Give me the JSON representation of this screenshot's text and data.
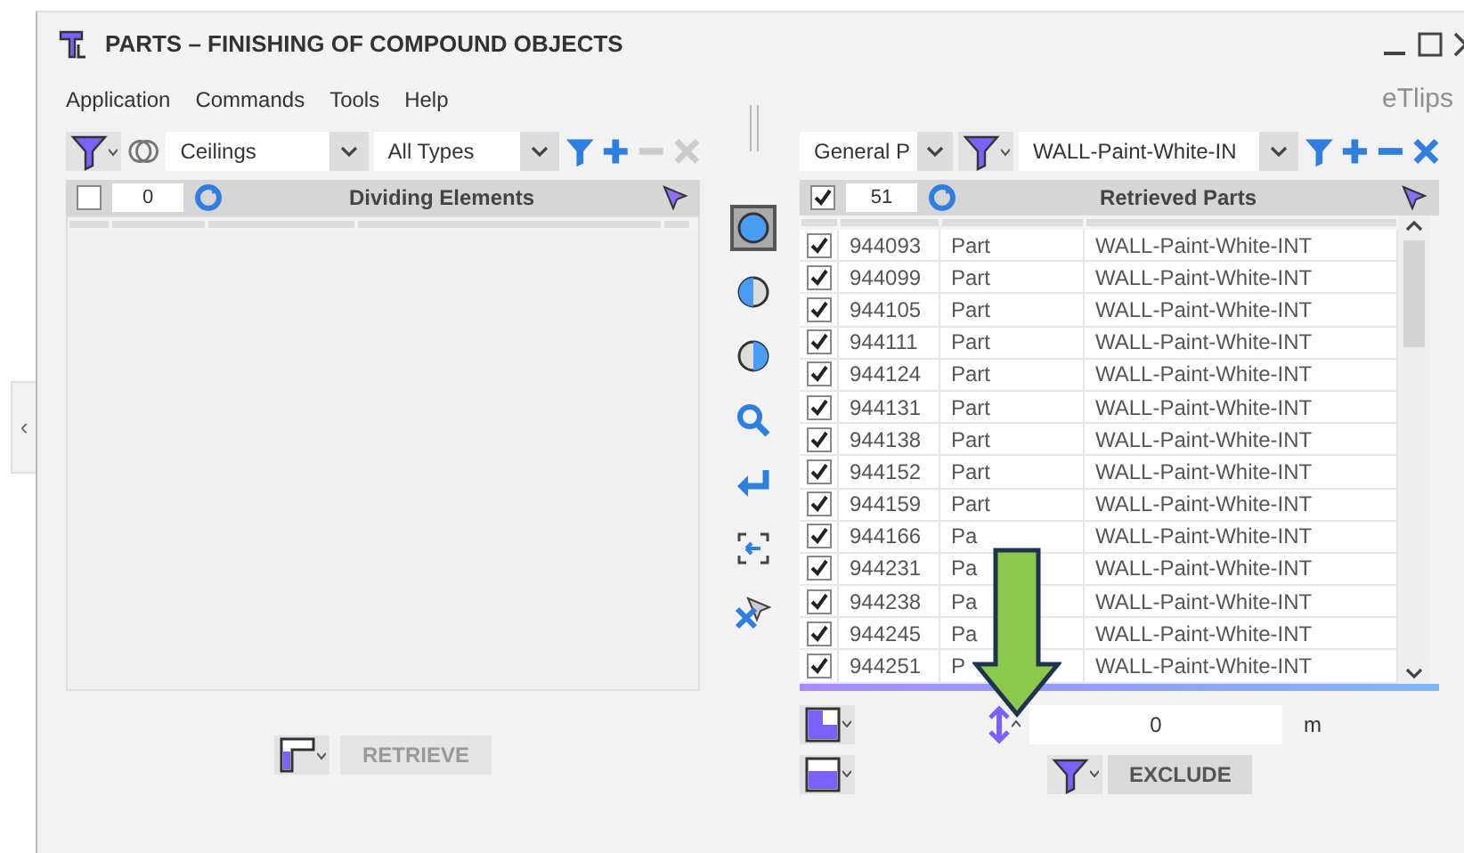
{
  "side_handle": {
    "glyph": "‹"
  },
  "window": {
    "title": "PARTS – FINISHING OF COMPOUND OBJECTS",
    "brand": "eTlips"
  },
  "menu": [
    "Application",
    "Commands",
    "Tools",
    "Help"
  ],
  "left_panel": {
    "toolbar": {
      "dropdowns": [
        {
          "value": "Ceilings"
        },
        {
          "value": "All Types"
        }
      ],
      "actions": [
        {
          "kind": "filter",
          "disabled": false
        },
        {
          "kind": "add",
          "disabled": false
        },
        {
          "kind": "remove",
          "disabled": true
        },
        {
          "kind": "clear",
          "disabled": true
        }
      ]
    },
    "header": {
      "checked": false,
      "count": "0",
      "title": "Dividing Elements"
    },
    "button": {
      "label": "RETRIEVE",
      "disabled": true
    }
  },
  "tools": [
    {
      "kind": "full",
      "selected": true
    },
    {
      "kind": "half-left",
      "selected": false
    },
    {
      "kind": "half-right",
      "selected": false
    },
    {
      "kind": "zoom",
      "selected": false
    },
    {
      "kind": "return",
      "selected": false
    },
    {
      "kind": "focus",
      "selected": false
    },
    {
      "kind": "deselect",
      "selected": false
    }
  ],
  "right_panel": {
    "toolbar": {
      "dropdowns": [
        {
          "value": "General P"
        },
        {
          "value": "WALL-Paint-White-IN"
        }
      ],
      "actions": [
        {
          "kind": "filter",
          "disabled": false
        },
        {
          "kind": "add",
          "disabled": false
        },
        {
          "kind": "remove",
          "disabled": false
        },
        {
          "kind": "clear",
          "disabled": false
        }
      ]
    },
    "header": {
      "checked": true,
      "count": "51",
      "title": "Retrieved Parts"
    },
    "rows": [
      {
        "id": "944093",
        "type": "Part",
        "name": "WALL-Paint-White-INT",
        "checked": true
      },
      {
        "id": "944099",
        "type": "Part",
        "name": "WALL-Paint-White-INT",
        "checked": true
      },
      {
        "id": "944105",
        "type": "Part",
        "name": "WALL-Paint-White-INT",
        "checked": true
      },
      {
        "id": "944111",
        "type": "Part",
        "name": "WALL-Paint-White-INT",
        "checked": true
      },
      {
        "id": "944124",
        "type": "Part",
        "name": "WALL-Paint-White-INT",
        "checked": true
      },
      {
        "id": "944131",
        "type": "Part",
        "name": "WALL-Paint-White-INT",
        "checked": true
      },
      {
        "id": "944138",
        "type": "Part",
        "name": "WALL-Paint-White-INT",
        "checked": true
      },
      {
        "id": "944152",
        "type": "Part",
        "name": "WALL-Paint-White-INT",
        "checked": true
      },
      {
        "id": "944159",
        "type": "Part",
        "name": "WALL-Paint-White-INT",
        "checked": true
      },
      {
        "id": "944166",
        "type": "Pa",
        "name": "WALL-Paint-White-INT",
        "checked": true
      },
      {
        "id": "944231",
        "type": "Pa",
        "name": "WALL-Paint-White-INT",
        "checked": true
      },
      {
        "id": "944238",
        "type": "Pa",
        "name": "WALL-Paint-White-INT",
        "checked": true
      },
      {
        "id": "944245",
        "type": "Pa",
        "name": "WALL-Paint-White-INT",
        "checked": true
      },
      {
        "id": "944251",
        "type": "P",
        "name": "WALL-Paint-White-INT",
        "checked": true
      }
    ],
    "offset": {
      "value": "0",
      "unit": "m"
    },
    "button": {
      "label": "EXCLUDE",
      "disabled": false
    }
  }
}
